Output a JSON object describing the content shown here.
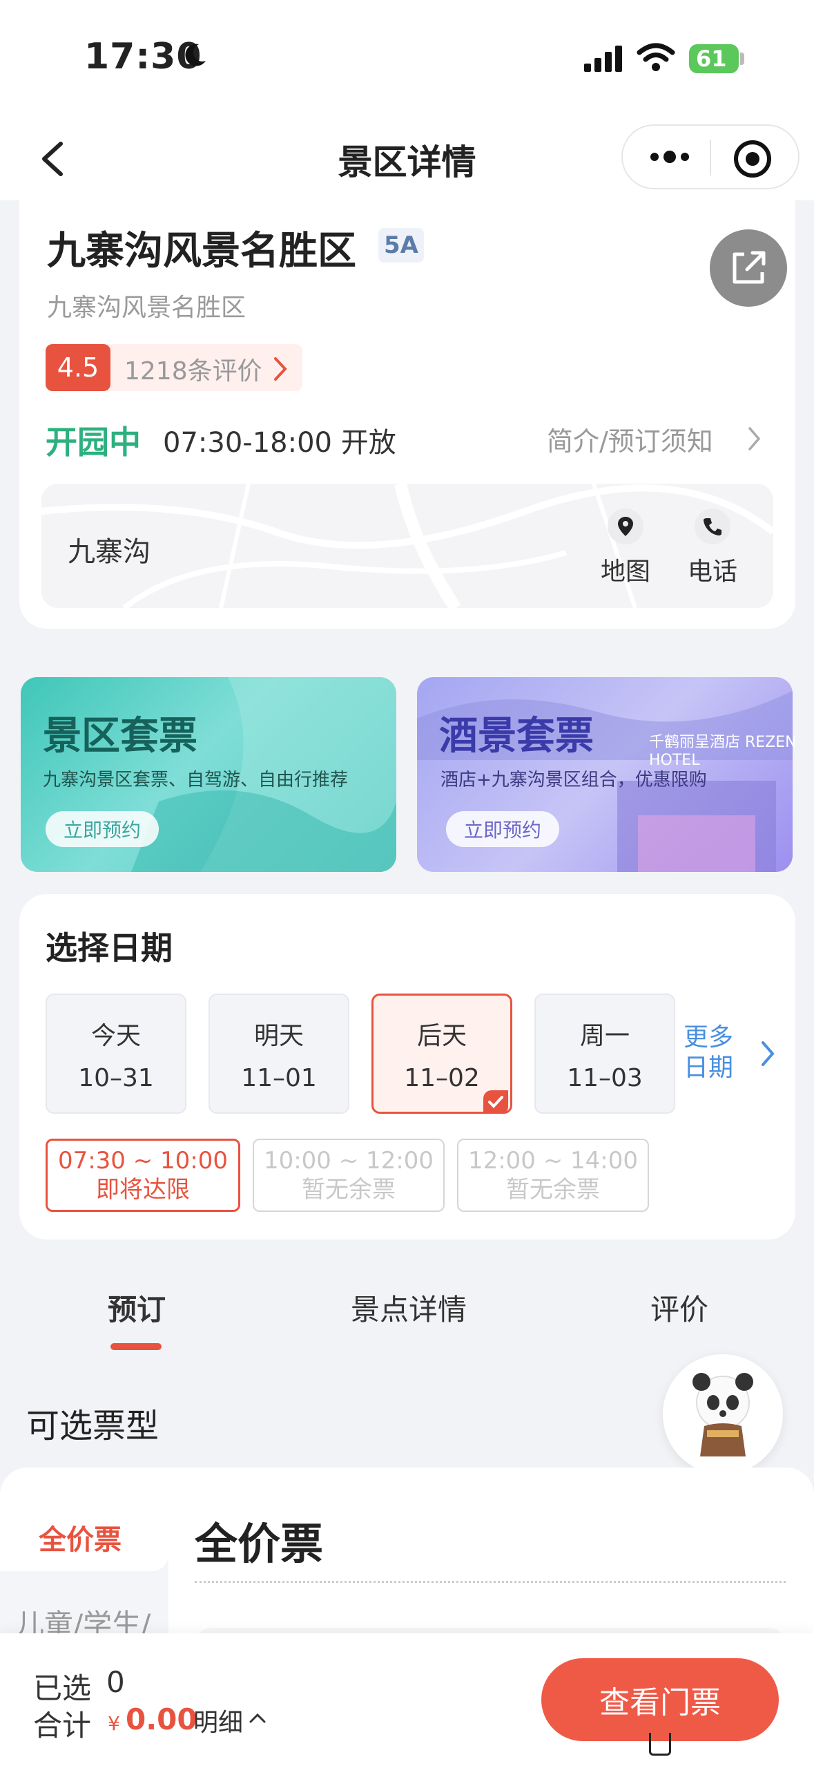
{
  "status_bar": {
    "time": "17:30",
    "battery": "61"
  },
  "nav": {
    "title": "景区详情"
  },
  "attraction": {
    "name": "九寨沟风景名胜区",
    "level": "5A",
    "subtitle": "九寨沟风景名胜区",
    "score": "4.5",
    "reviews": "1218条评价",
    "open_status": "开园中",
    "hours": "07:30-18:00 开放",
    "intro_link": "简介/预订须知",
    "map_place": "九寨沟",
    "map_label": "地图",
    "phone_label": "电话"
  },
  "banners": [
    {
      "title": "景区套票",
      "desc": "九寨沟景区套票、自驾游、自由行推荐",
      "button": "立即预约"
    },
    {
      "title": "酒景套票",
      "desc": "酒店+九寨沟景区组合，优惠限购",
      "button": "立即预约",
      "hotel": "千鹤丽呈酒店 REZEN HOTEL"
    }
  ],
  "date_picker": {
    "title": "选择日期",
    "days": [
      {
        "label": "今天",
        "date": "10–31"
      },
      {
        "label": "明天",
        "date": "11–01"
      },
      {
        "label": "后天",
        "date": "11–02",
        "selected": true
      },
      {
        "label": "周一",
        "date": "11–03"
      }
    ],
    "more": "更多日期",
    "slots": [
      {
        "time": "07:30 ~ 10:00",
        "status": "即将达限",
        "available": true
      },
      {
        "time": "10:00 ~ 12:00",
        "status": "暂无余票",
        "available": false
      },
      {
        "time": "12:00 ~ 14:00",
        "status": "暂无余票",
        "available": false
      }
    ]
  },
  "tabs": [
    "预订",
    "景点详情",
    "评价"
  ],
  "tickets": {
    "section_title": "可选票型",
    "categories": [
      "全价票",
      "儿童/学生/"
    ],
    "current": "全价票"
  },
  "bottom": {
    "selected_label": "已选",
    "selected_count": "0",
    "total_label": "合计",
    "currency": "¥",
    "total": "0.00",
    "detail": "明细",
    "cta": "查看门票"
  },
  "colors": {
    "accent": "#e8533f",
    "open_green": "#2db07f",
    "link_blue": "#4a8fe0"
  }
}
